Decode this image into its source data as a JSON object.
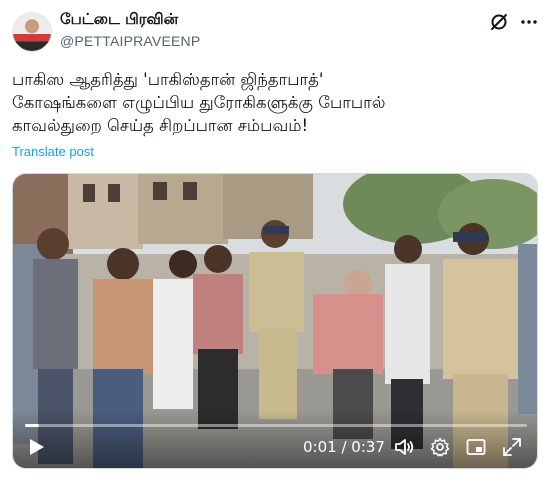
{
  "author": {
    "display_name": "பேட்டை பிரவின்",
    "handle": "@PETTAIPRAVEENP"
  },
  "header_icons": [
    "grok-icon",
    "more-options-icon"
  ],
  "tweet": {
    "lines": [
      "பாகிஸ ஆதரித்து 'பாகிஸ்தான் ஜிந்தாபாத்'",
      "கோஷங்களை எழுப்பிய துரோகிகளுக்கு போபால்",
      "காவல்துறை செய்த சிறப்பான சம்பவம்!"
    ],
    "translate_label": "Translate post"
  },
  "video": {
    "progress_fraction": 0.027,
    "time_display": "0:01 / 0:37",
    "controls": [
      "play-icon",
      "volume-icon",
      "settings-gear-icon",
      "picture-in-picture-icon",
      "fullscreen-icon"
    ]
  },
  "colors": {
    "link": "#1d9bf0",
    "secondary_text": "#536471",
    "primary_text": "#0f1419"
  }
}
